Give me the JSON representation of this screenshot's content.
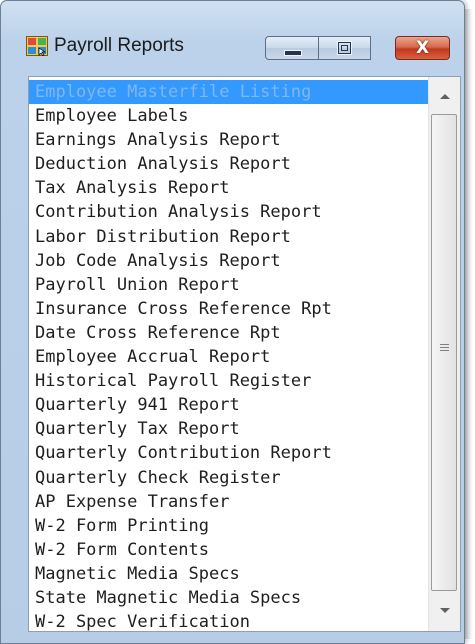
{
  "window": {
    "title": "Payroll Reports",
    "close_symbol": "X",
    "icons": {
      "app": "payroll-app-icon",
      "minimize": "minimize-icon",
      "maximize": "restore-icon",
      "close": "close-icon"
    }
  },
  "list": {
    "selected_index": 0,
    "selection_color": "#3399ff",
    "items": [
      "Employee Masterfile Listing",
      "Employee Labels",
      "Earnings Analysis Report",
      "Deduction Analysis Report",
      "Tax Analysis Report",
      "Contribution Analysis Report",
      "Labor Distribution Report",
      "Job Code Analysis Report",
      "Payroll Union Report",
      "Insurance Cross Reference Rpt",
      "Date Cross Reference Rpt",
      "Employee Accrual Report",
      "Historical Payroll Register",
      "Quarterly 941 Report",
      "Quarterly Tax Report",
      "Quarterly Contribution Report",
      "Quarterly Check Register",
      "AP Expense Transfer",
      "W-2 Form Printing",
      "W-2 Form Contents",
      "Magnetic Media Specs",
      "State Magnetic Media Specs",
      "W-2 Spec Verification"
    ]
  }
}
